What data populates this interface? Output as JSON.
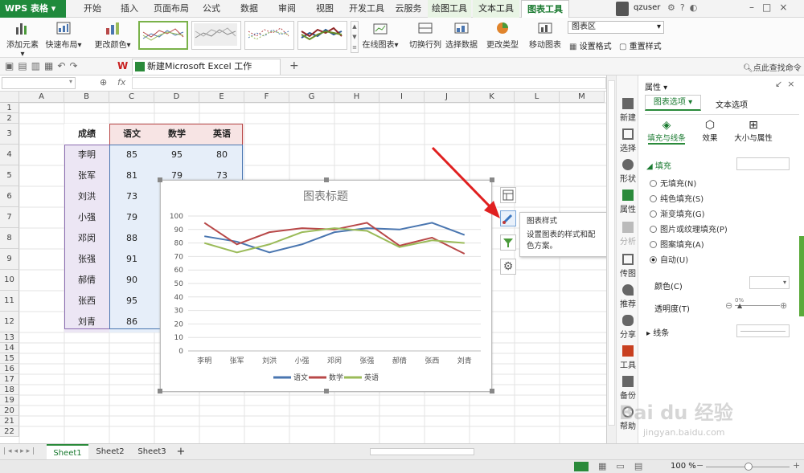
{
  "app": {
    "name": "WPS 表格"
  },
  "tabs": [
    "开始",
    "插入",
    "页面布局",
    "公式",
    "数据",
    "审阅",
    "视图",
    "开发工具",
    "云服务"
  ],
  "context_tabs": [
    "绘图工具",
    "文本工具",
    "图表工具"
  ],
  "user": {
    "name": "qzuser"
  },
  "ribbon": {
    "add_element": "添加元素",
    "quick_layout": "快速布局",
    "change_color": "更改颜色",
    "online_chart": "在线图表",
    "switch_rowcol": "切换行列",
    "select_data": "选择数据",
    "change_type": "更改类型",
    "move_chart": "移动图表",
    "area_select": "图表区",
    "set_format": "设置格式",
    "reset_style": "重置样式"
  },
  "document": {
    "tab_title": "新建Microsoft Excel 工作表.xlsx *",
    "search": "点此查找命令"
  },
  "formula_bar": {
    "fx": "fx"
  },
  "columns": [
    "A",
    "B",
    "C",
    "D",
    "E",
    "F",
    "G",
    "H",
    "I",
    "J",
    "K",
    "L",
    "M"
  ],
  "rows": [
    "1",
    "2",
    "3",
    "4",
    "5",
    "6",
    "7",
    "8",
    "9",
    "10",
    "11",
    "12",
    "13",
    "14",
    "15",
    "16",
    "17",
    "18",
    "19",
    "20",
    "21",
    "22"
  ],
  "table": {
    "headers": [
      "成绩",
      "语文",
      "数学",
      "英语"
    ],
    "rows": [
      {
        "name": "李明",
        "v": [
          "85",
          "95",
          "80"
        ]
      },
      {
        "name": "张军",
        "v": [
          "81",
          "79",
          "73"
        ]
      },
      {
        "name": "刘洪",
        "v": [
          "73",
          "",
          ""
        ]
      },
      {
        "name": "小强",
        "v": [
          "79",
          "",
          ""
        ]
      },
      {
        "name": "邓闵",
        "v": [
          "88",
          "",
          ""
        ]
      },
      {
        "name": "张强",
        "v": [
          "91",
          "",
          ""
        ]
      },
      {
        "name": "郝倩",
        "v": [
          "90",
          "",
          ""
        ]
      },
      {
        "name": "张西",
        "v": [
          "95",
          "",
          ""
        ]
      },
      {
        "name": "刘青",
        "v": [
          "86",
          "",
          ""
        ]
      }
    ]
  },
  "chart_data": {
    "type": "line",
    "title": "图表标题",
    "categories": [
      "李明",
      "张军",
      "刘洪",
      "小强",
      "邓闵",
      "张强",
      "郝倩",
      "张西",
      "刘青"
    ],
    "series": [
      {
        "name": "语文",
        "color": "#4a76b0",
        "values": [
          85,
          81,
          73,
          79,
          88,
          91,
          90,
          95,
          86
        ]
      },
      {
        "name": "数学",
        "color": "#b84848",
        "values": [
          95,
          79,
          88,
          91,
          90,
          95,
          78,
          84,
          72
        ]
      },
      {
        "name": "英语",
        "color": "#9bbb59",
        "values": [
          80,
          73,
          79,
          88,
          91,
          89,
          77,
          82,
          80
        ]
      }
    ],
    "ylim": [
      0,
      100
    ],
    "yticks": [
      "0",
      "10",
      "20",
      "30",
      "40",
      "50",
      "60",
      "70",
      "80",
      "90",
      "100"
    ],
    "legend": "bottom",
    "grid": true
  },
  "tooltip": {
    "title": "图表样式",
    "desc": "设置图表的样式和配色方案。"
  },
  "sidetools": [
    "新建",
    "选择",
    "形状",
    "属性",
    "分析",
    "传图",
    "推荐",
    "分享",
    "工具",
    "备份",
    "帮助"
  ],
  "panel": {
    "title": "属性",
    "tab_chart": "图表选项",
    "tab_text": "文本选项",
    "sub_fill": "填充与线条",
    "sub_effect": "效果",
    "sub_size": "大小与属性",
    "section_fill": "填充",
    "options": [
      "无填充(N)",
      "纯色填充(S)",
      "渐变填充(G)",
      "图片或纹理填充(P)",
      "图案填充(A)",
      "自动(U)"
    ],
    "color_label": "颜色(C)",
    "transparency_label": "透明度(T)",
    "transparency_value": "0%",
    "line_label": "线条"
  },
  "sheets": [
    "Sheet1",
    "Sheet2",
    "Sheet3"
  ],
  "status": {
    "zoom": "100 %"
  },
  "watermark": {
    "text": "Bai du 经验",
    "sub": "jingyan.baidu.com"
  }
}
